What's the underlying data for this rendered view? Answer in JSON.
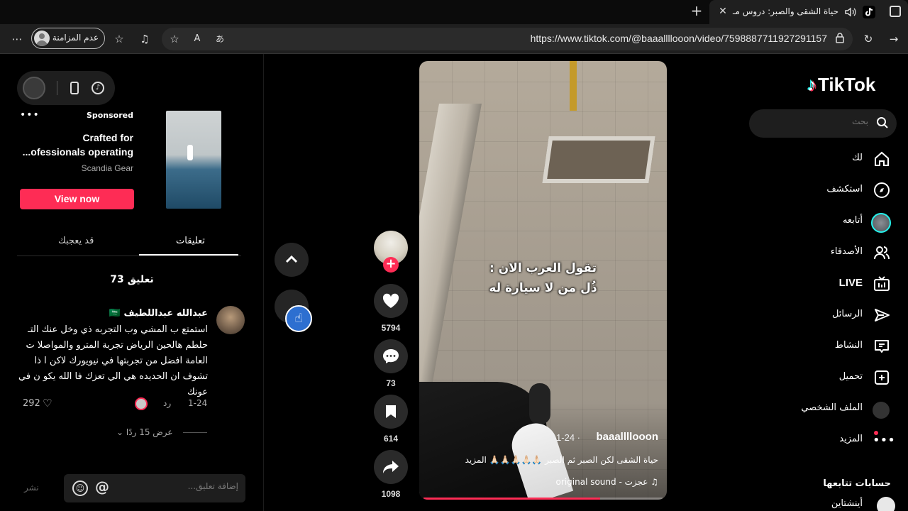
{
  "browser": {
    "tab_title": "حياة الشقى والصبر: دروس مـ",
    "url": "https://www.tiktok.com/@baaallllooon/video/7598887711927291157",
    "profile_label": "عدم المزامنة"
  },
  "sidebar": {
    "search_placeholder": "بحث",
    "items": [
      {
        "label": "لك",
        "icon": "home-icon"
      },
      {
        "label": "استكشف",
        "icon": "compass-icon"
      },
      {
        "label": "أتابعه",
        "icon": "following-avatar"
      },
      {
        "label": "الأصدقاء",
        "icon": "friends-icon"
      },
      {
        "label": "LIVE",
        "icon": "live-tv-icon"
      },
      {
        "label": "الرسائل",
        "icon": "send-icon"
      },
      {
        "label": "النشاط",
        "icon": "activity-icon"
      },
      {
        "label": "تحميل",
        "icon": "upload-icon"
      },
      {
        "label": "الملف الشخصي",
        "icon": "profile-avatar"
      },
      {
        "label": "المزيد",
        "icon": "more-icon"
      }
    ],
    "following_title": "حسابات تتابعها",
    "following_user": "أينشتاين"
  },
  "logo": {
    "text": "TikTok"
  },
  "video": {
    "overlay_line1": "تقول العرب الان :",
    "overlay_line2": "ذُل من لا سيارة له",
    "author": "baaallllooon",
    "date": "1-24 ·",
    "caption": "حياة الشقى لكن الصبر ثم الصبر 🙏🏻🙏🏻🙏🏻🙏🏻🙏🏻 المزيد",
    "sound": "♫ عجزت - original sound",
    "progress": 0.74
  },
  "actions": {
    "likes": "5794",
    "comments": "73",
    "saves": "614",
    "shares": "1098"
  },
  "ad": {
    "sponsored": "Sponsored",
    "title_line1": "Crafted for",
    "title_line2": "...ofessionals operating",
    "brand": "Scandia Gear",
    "cta": "View now"
  },
  "comments_panel": {
    "tab_comments": "تعليقات",
    "tab_you_may_like": "قد يعجبك",
    "count_label": "73 تعليق",
    "comment": {
      "author": "عبدالله عبداللطيف 🇸🇦",
      "text": "استمتع ب المشي وب التجربه ذي وخل عنك التـ حلطم هالحين الرياض تجربة المترو والمواصلا ت العامة افضل من تجربتها في نيويورك لاكن ا ذا تشوف ان الحديده هي الي تعزك فا الله يكو ن في عونك",
      "date": "1-24",
      "reply_label": "رد",
      "likes": "292"
    },
    "view_replies": "عرض 15 ردًا",
    "input_placeholder": "إضافة تعليق...",
    "post_label": "نشر"
  }
}
